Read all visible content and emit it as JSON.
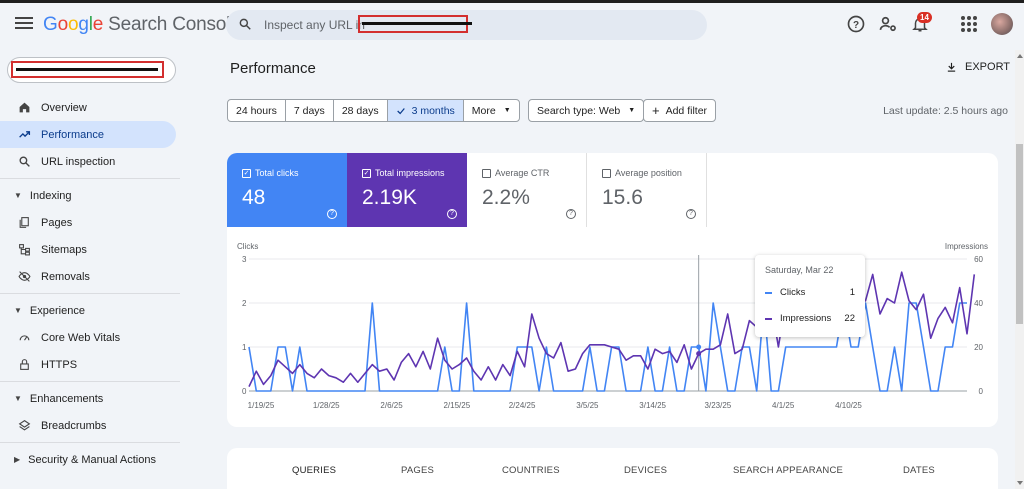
{
  "app": {
    "logo_google": "Google",
    "logo_product": "Search Console",
    "logo_colors": [
      "#4285f4",
      "#ea4335",
      "#fbbc05",
      "#4285f4",
      "#34a853",
      "#ea4335"
    ]
  },
  "search": {
    "placeholder": "Inspect any URL in"
  },
  "header": {
    "notification_count": "14"
  },
  "sidebar": {
    "items": [
      {
        "label": "Overview",
        "icon": "home-icon"
      },
      {
        "label": "Performance",
        "icon": "trending-up-icon",
        "active": true
      },
      {
        "label": "URL inspection",
        "icon": "search-icon"
      }
    ],
    "indexing": {
      "label": "Indexing",
      "items": [
        {
          "label": "Pages"
        },
        {
          "label": "Sitemaps"
        },
        {
          "label": "Removals"
        }
      ]
    },
    "experience": {
      "label": "Experience",
      "items": [
        {
          "label": "Core Web Vitals"
        },
        {
          "label": "HTTPS"
        }
      ]
    },
    "enhancements": {
      "label": "Enhancements",
      "items": [
        {
          "label": "Breadcrumbs"
        }
      ]
    },
    "security": {
      "label": "Security & Manual Actions"
    }
  },
  "main": {
    "title": "Performance",
    "export_label": "EXPORT",
    "ranges": [
      "24 hours",
      "7 days",
      "28 days",
      "3 months"
    ],
    "selected_range": "3 months",
    "more_label": "More",
    "search_type": "Search type: Web",
    "add_filter": "Add filter",
    "last_update": "Last update: 2.5 hours ago"
  },
  "metrics": {
    "clicks": {
      "label": "Total clicks",
      "value": "48",
      "color": "#4285f4"
    },
    "impressions": {
      "label": "Total impressions",
      "value": "2.19K",
      "color": "#5e35b1"
    },
    "ctr": {
      "label": "Average CTR",
      "value": "2.2%"
    },
    "position": {
      "label": "Average position",
      "value": "15.6"
    }
  },
  "tooltip": {
    "date": "Saturday, Mar 22",
    "clicks_label": "Clicks",
    "clicks_value": "1",
    "impressions_label": "Impressions",
    "impressions_value": "22"
  },
  "chart_data": {
    "type": "line",
    "ylabel_left": "Clicks",
    "ylabel_right": "Impressions",
    "left_ylim": [
      0,
      3
    ],
    "right_ylim": [
      0,
      60
    ],
    "left_ticks": [
      "0",
      "1",
      "2",
      "3"
    ],
    "right_ticks": [
      "0",
      "20",
      "40",
      "60"
    ],
    "x_tick_labels": [
      "1/19/25",
      "1/28/25",
      "2/6/25",
      "2/15/25",
      "2/24/25",
      "3/5/25",
      "3/14/25",
      "3/23/25",
      "4/1/25",
      "4/10/25"
    ],
    "highlight_date": "Saturday, Mar 22",
    "series": [
      {
        "name": "Clicks",
        "color": "#4285f4",
        "values": [
          1,
          0,
          0,
          0,
          1,
          1,
          0,
          1,
          0,
          0,
          0,
          0,
          0,
          0,
          0,
          0,
          0,
          2,
          0,
          0,
          0,
          0,
          0,
          0,
          0,
          0,
          0,
          1,
          0,
          0,
          2,
          0,
          0,
          0,
          0,
          0,
          0,
          1,
          1,
          1,
          0,
          1,
          0,
          0,
          0,
          0,
          0,
          1,
          0,
          0,
          1,
          1,
          0,
          0,
          0,
          1,
          0,
          0,
          1,
          0,
          0,
          1,
          1,
          0,
          2,
          1,
          0,
          0,
          1,
          1,
          0,
          2,
          0,
          0,
          1,
          1,
          1,
          1,
          1,
          1,
          1,
          1,
          2,
          1,
          1,
          2,
          1,
          0,
          0,
          1,
          0,
          2,
          2,
          1,
          0,
          0,
          1,
          1,
          2,
          2
        ]
      },
      {
        "name": "Impressions",
        "color": "#5e35b1",
        "values": [
          2,
          9,
          3,
          7,
          14,
          11,
          8,
          12,
          8,
          6,
          10,
          7,
          6,
          4,
          8,
          4,
          8,
          12,
          9,
          10,
          5,
          13,
          17,
          11,
          18,
          10,
          24,
          14,
          10,
          12,
          15,
          9,
          5,
          11,
          5,
          12,
          7,
          18,
          11,
          35,
          24,
          17,
          15,
          22,
          9,
          10,
          17,
          21,
          21,
          21,
          20,
          19,
          14,
          16,
          16,
          10,
          19,
          17,
          18,
          13,
          21,
          10,
          17,
          19,
          19,
          21,
          35,
          17,
          19,
          32,
          29,
          38,
          40,
          20,
          41,
          44,
          26,
          37,
          29,
          35,
          25,
          28,
          26,
          38,
          40,
          41,
          53,
          35,
          42,
          40,
          54,
          41,
          37,
          44,
          24,
          33,
          38,
          31,
          47,
          26,
          53
        ]
      }
    ]
  },
  "bottom_tabs": [
    "QUERIES",
    "PAGES",
    "COUNTRIES",
    "DEVICES",
    "SEARCH APPEARANCE",
    "DATES"
  ]
}
